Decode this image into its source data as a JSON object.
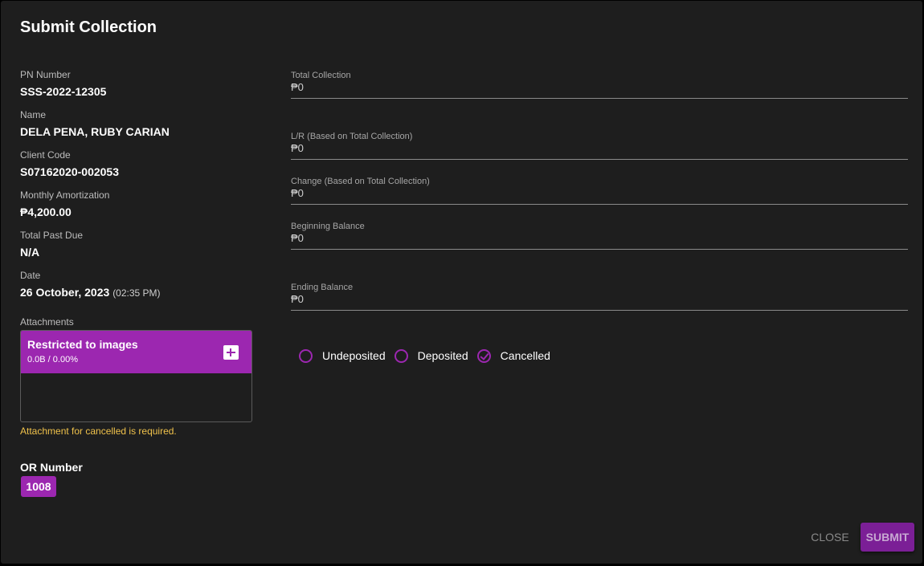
{
  "dialog": {
    "title": "Submit Collection"
  },
  "info": {
    "pn_label": "PN Number",
    "pn_value": "SSS-2022-12305",
    "name_label": "Name",
    "name_value": "DELA PENA, RUBY CARIAN",
    "client_label": "Client Code",
    "client_value": "S07162020-002053",
    "amort_label": "Monthly Amortization",
    "amort_value": "₱4,200.00",
    "pastdue_label": "Total Past Due",
    "pastdue_value": "N/A",
    "date_label": "Date",
    "date_value": "26 October, 2023",
    "time_value": "(02:35 PM)"
  },
  "attachments": {
    "label": "Attachments",
    "title": "Restricted to images",
    "size": "0.0B / 0.00%",
    "error": "Attachment for cancelled is required."
  },
  "or": {
    "label": "OR Number",
    "value": "1008"
  },
  "fields": {
    "total_collection": {
      "label": "Total Collection",
      "value": "₱0"
    },
    "lr": {
      "label": "L/R (Based on Total Collection)",
      "value": "₱0"
    },
    "change": {
      "label": "Change (Based on Total Collection)",
      "value": "₱0"
    },
    "beginning_balance": {
      "label": "Beginning Balance",
      "value": "₱0"
    },
    "ending_balance": {
      "label": "Ending Balance",
      "value": "₱0"
    }
  },
  "status": {
    "options": [
      "Undeposited",
      "Deposited",
      "Cancelled"
    ],
    "selected": "Cancelled"
  },
  "actions": {
    "close": "CLOSE",
    "submit": "SUBMIT"
  },
  "colors": {
    "accent": "#9c27b0",
    "background": "#1e1e1e",
    "warning": "#f0c24b"
  },
  "icons": {
    "add": "add-box-icon",
    "radio": "radio-circle-icon",
    "radio_checked": "check-circle-icon"
  }
}
